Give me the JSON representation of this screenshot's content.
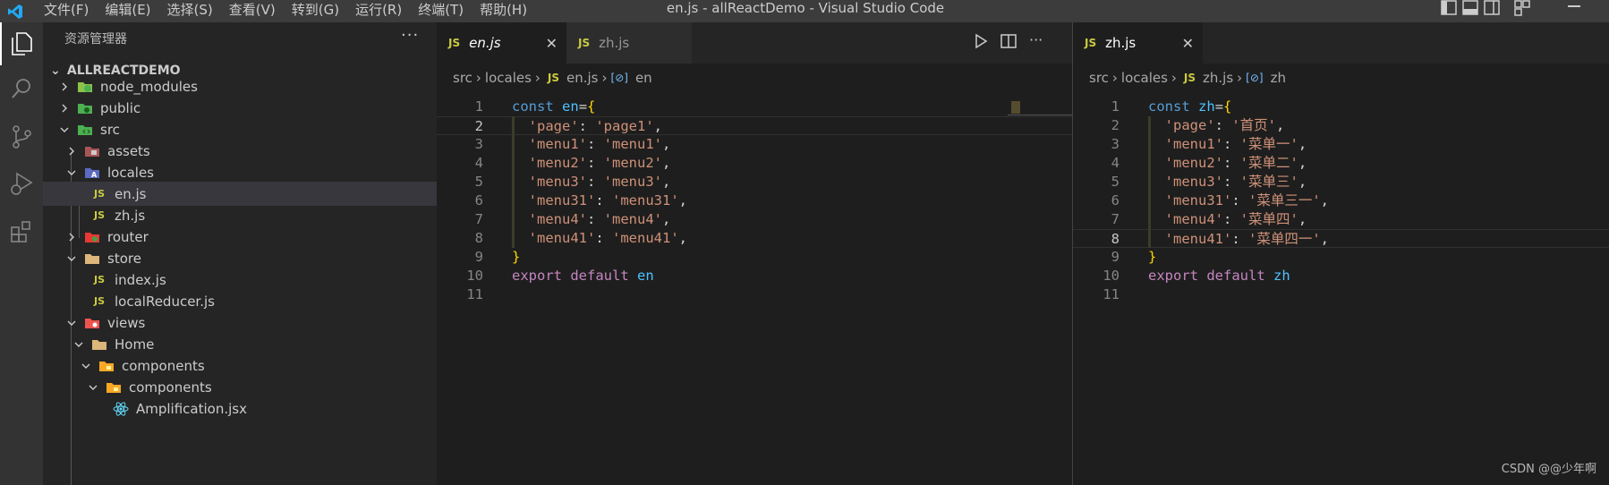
{
  "titlebar": {
    "menus": [
      "文件(F)",
      "编辑(E)",
      "选择(S)",
      "查看(V)",
      "转到(G)",
      "运行(R)",
      "终端(T)",
      "帮助(H)"
    ],
    "window_title": "en.js - allReactDemo - Visual Studio Code"
  },
  "sidebar": {
    "header": "资源管理器",
    "more": "···",
    "root": "ALLREACTDEMO",
    "items": [
      {
        "label": "node_modules",
        "icon": "folder-node-icon"
      },
      {
        "label": "public",
        "icon": "folder-public-icon"
      },
      {
        "label": "src",
        "icon": "folder-src-icon"
      },
      {
        "label": "assets",
        "icon": "folder-assets-icon"
      },
      {
        "label": "locales",
        "icon": "folder-locales-icon"
      },
      {
        "label": "en.js",
        "icon": "js-file-icon"
      },
      {
        "label": "zh.js",
        "icon": "js-file-icon"
      },
      {
        "label": "router",
        "icon": "folder-router-icon"
      },
      {
        "label": "store",
        "icon": "folder-icon"
      },
      {
        "label": "index.js",
        "icon": "js-file-icon"
      },
      {
        "label": "localReducer.js",
        "icon": "js-file-icon"
      },
      {
        "label": "views",
        "icon": "folder-views-icon"
      },
      {
        "label": "Home",
        "icon": "folder-icon"
      },
      {
        "label": "components",
        "icon": "folder-components-icon"
      },
      {
        "label": "components",
        "icon": "folder-components-icon"
      },
      {
        "label": "Amplification.jsx",
        "icon": "react-icon"
      }
    ],
    "js_badge": "JS"
  },
  "editor1": {
    "tabs": [
      {
        "label": "en.js",
        "badge": "JS"
      },
      {
        "label": "zh.js",
        "badge": "JS"
      }
    ],
    "breadcrumbs": {
      "p1": "src",
      "p2": "locales",
      "badge": "JS",
      "file": "en.js",
      "symbol": "en"
    },
    "lines": [
      {
        "n": "1",
        "parts": [
          [
            "kw",
            "const"
          ],
          [
            "punc",
            " "
          ],
          [
            "var",
            "en"
          ],
          [
            "punc",
            "="
          ],
          [
            "brace",
            "{"
          ]
        ]
      },
      {
        "n": "2",
        "parts": [
          [
            "punc",
            "  "
          ],
          [
            "str",
            "'page'"
          ],
          [
            "punc",
            ": "
          ],
          [
            "str",
            "'page1'"
          ],
          [
            "punc",
            ","
          ]
        ]
      },
      {
        "n": "3",
        "parts": [
          [
            "punc",
            "  "
          ],
          [
            "str",
            "'menu1'"
          ],
          [
            "punc",
            ": "
          ],
          [
            "str",
            "'menu1'"
          ],
          [
            "punc",
            ","
          ]
        ]
      },
      {
        "n": "4",
        "parts": [
          [
            "punc",
            "  "
          ],
          [
            "str",
            "'menu2'"
          ],
          [
            "punc",
            ": "
          ],
          [
            "str",
            "'menu2'"
          ],
          [
            "punc",
            ","
          ]
        ]
      },
      {
        "n": "5",
        "parts": [
          [
            "punc",
            "  "
          ],
          [
            "str",
            "'menu3'"
          ],
          [
            "punc",
            ": "
          ],
          [
            "str",
            "'menu3'"
          ],
          [
            "punc",
            ","
          ]
        ]
      },
      {
        "n": "6",
        "parts": [
          [
            "punc",
            "  "
          ],
          [
            "str",
            "'menu31'"
          ],
          [
            "punc",
            ": "
          ],
          [
            "str",
            "'menu31'"
          ],
          [
            "punc",
            ","
          ]
        ]
      },
      {
        "n": "7",
        "parts": [
          [
            "punc",
            "  "
          ],
          [
            "str",
            "'menu4'"
          ],
          [
            "punc",
            ": "
          ],
          [
            "str",
            "'menu4'"
          ],
          [
            "punc",
            ","
          ]
        ]
      },
      {
        "n": "8",
        "parts": [
          [
            "punc",
            "  "
          ],
          [
            "str",
            "'menu41'"
          ],
          [
            "punc",
            ": "
          ],
          [
            "str",
            "'menu41'"
          ],
          [
            "punc",
            ","
          ]
        ]
      },
      {
        "n": "9",
        "parts": [
          [
            "brace",
            "}"
          ]
        ]
      },
      {
        "n": "10",
        "parts": [
          [
            "kw2",
            "export"
          ],
          [
            "punc",
            " "
          ],
          [
            "kw2",
            "default"
          ],
          [
            "punc",
            " "
          ],
          [
            "var",
            "en"
          ]
        ]
      },
      {
        "n": "11",
        "parts": []
      }
    ],
    "current_line": 2
  },
  "editor2": {
    "tabs": [
      {
        "label": "zh.js",
        "badge": "JS"
      }
    ],
    "breadcrumbs": {
      "p1": "src",
      "p2": "locales",
      "badge": "JS",
      "file": "zh.js",
      "symbol": "zh"
    },
    "lines": [
      {
        "n": "1",
        "parts": [
          [
            "kw",
            "const"
          ],
          [
            "punc",
            " "
          ],
          [
            "var",
            "zh"
          ],
          [
            "punc",
            "="
          ],
          [
            "brace",
            "{"
          ]
        ]
      },
      {
        "n": "2",
        "parts": [
          [
            "punc",
            "  "
          ],
          [
            "str",
            "'page'"
          ],
          [
            "punc",
            ": "
          ],
          [
            "str",
            "'首页'"
          ],
          [
            "punc",
            ","
          ]
        ]
      },
      {
        "n": "3",
        "parts": [
          [
            "punc",
            "  "
          ],
          [
            "str",
            "'menu1'"
          ],
          [
            "punc",
            ": "
          ],
          [
            "str",
            "'菜单一'"
          ],
          [
            "punc",
            ","
          ]
        ]
      },
      {
        "n": "4",
        "parts": [
          [
            "punc",
            "  "
          ],
          [
            "str",
            "'menu2'"
          ],
          [
            "punc",
            ": "
          ],
          [
            "str",
            "'菜单二'"
          ],
          [
            "punc",
            ","
          ]
        ]
      },
      {
        "n": "5",
        "parts": [
          [
            "punc",
            "  "
          ],
          [
            "str",
            "'menu3'"
          ],
          [
            "punc",
            ": "
          ],
          [
            "str",
            "'菜单三'"
          ],
          [
            "punc",
            ","
          ]
        ]
      },
      {
        "n": "6",
        "parts": [
          [
            "punc",
            "  "
          ],
          [
            "str",
            "'menu31'"
          ],
          [
            "punc",
            ": "
          ],
          [
            "str",
            "'菜单三一'"
          ],
          [
            "punc",
            ","
          ]
        ]
      },
      {
        "n": "7",
        "parts": [
          [
            "punc",
            "  "
          ],
          [
            "str",
            "'menu4'"
          ],
          [
            "punc",
            ": "
          ],
          [
            "str",
            "'菜单四'"
          ],
          [
            "punc",
            ","
          ]
        ]
      },
      {
        "n": "8",
        "parts": [
          [
            "punc",
            "  "
          ],
          [
            "str",
            "'menu41'"
          ],
          [
            "punc",
            ": "
          ],
          [
            "str",
            "'菜单四一'"
          ],
          [
            "punc",
            ","
          ]
        ]
      },
      {
        "n": "9",
        "parts": [
          [
            "brace",
            "}"
          ]
        ]
      },
      {
        "n": "10",
        "parts": [
          [
            "kw2",
            "export"
          ],
          [
            "punc",
            " "
          ],
          [
            "kw2",
            "default"
          ],
          [
            "punc",
            " "
          ],
          [
            "var",
            "zh"
          ]
        ]
      },
      {
        "n": "11",
        "parts": []
      }
    ],
    "current_line": 8
  },
  "watermark": "CSDN @@少年啊",
  "colors": {
    "keyword": "#569cd6",
    "keyword_control": "#c586c0",
    "variable": "#4fc1ff",
    "string": "#ce9178",
    "brace": "#ffd700",
    "js_badge": "#cbcb41"
  }
}
